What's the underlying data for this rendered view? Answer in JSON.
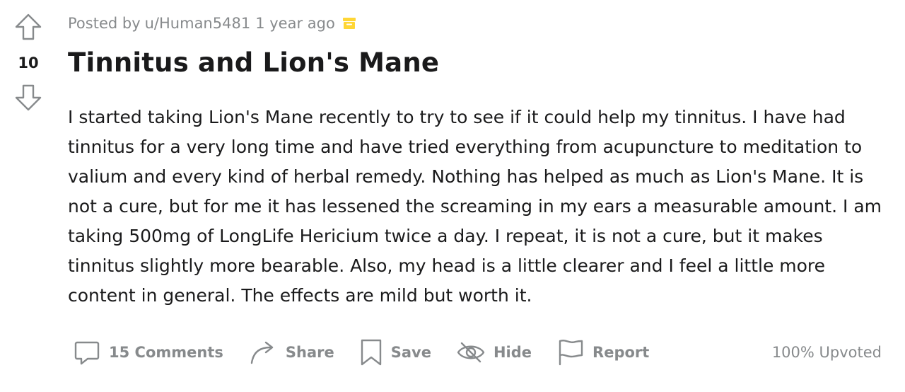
{
  "post": {
    "vote_count": "10",
    "meta": {
      "posted_by_prefix": "Posted by",
      "author": "u/Human5481",
      "time": "1 year ago",
      "archive_icon": "archive-box-icon",
      "archive_color": "#ffd635"
    },
    "title": "Tinnitus and Lion's Mane",
    "body": "I started taking Lion's Mane recently to try to see if it could help my tinnitus. I have had tinnitus for a very long time and have tried everything from acupuncture to meditation to valium and every kind of herbal remedy. Nothing has helped as much as Lion's Mane. It is not a cure, but for me it has lessened the screaming in my ears a measurable amount. I am taking 500mg of LongLife Hericium twice a day. I repeat, it is not a cure, but it makes tinnitus slightly more bearable. Also, my head is a little clearer and I feel a little more content in general. The effects are mild but worth it.",
    "actions": {
      "comments_label": "15 Comments",
      "share_label": "Share",
      "save_label": "Save",
      "hide_label": "Hide",
      "report_label": "Report"
    },
    "upvoted_text": "100% Upvoted"
  },
  "colors": {
    "text": "#1a1a1b",
    "muted": "#878a8c",
    "icon_gray": "#878a8c"
  },
  "icons": {
    "upvote": "upvote-arrow-icon",
    "downvote": "downvote-arrow-icon",
    "comments": "comment-bubble-icon",
    "share": "share-arrow-icon",
    "save": "bookmark-icon",
    "hide": "eye-slash-icon",
    "report": "flag-icon"
  }
}
